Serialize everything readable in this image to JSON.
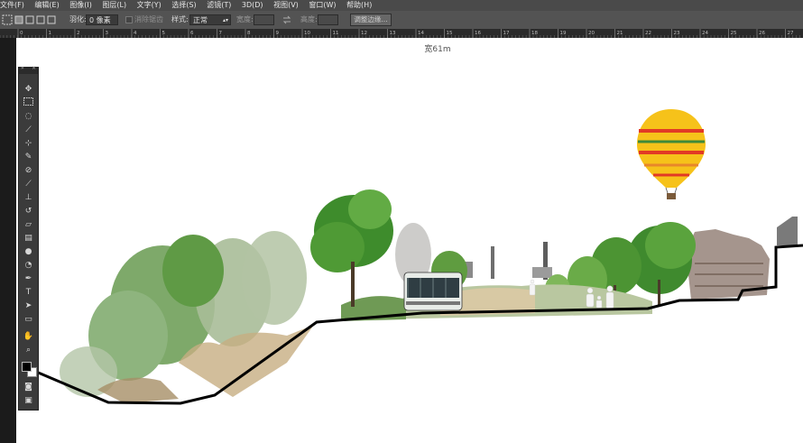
{
  "menu": [
    "文件(F)",
    "编辑(E)",
    "图像(I)",
    "图层(L)",
    "文字(Y)",
    "选择(S)",
    "滤镜(T)",
    "3D(D)",
    "视图(V)",
    "窗口(W)",
    "帮助(H)"
  ],
  "options": {
    "feather_label": "羽化:",
    "feather_value": "0 像素",
    "antialias_label": "消除锯齿",
    "style_label": "样式:",
    "style_value": "正常",
    "width_label": "宽度:",
    "height_label": "高度:",
    "refine_button": "调整边缘..."
  },
  "ruler": {
    "numbers": [
      "0",
      "1",
      "2",
      "3",
      "4",
      "5",
      "6",
      "7",
      "8",
      "9",
      "10",
      "11",
      "12",
      "13",
      "14",
      "15",
      "16",
      "17",
      "18",
      "19",
      "20",
      "21",
      "22",
      "23",
      "24",
      "25",
      "26",
      "27"
    ]
  },
  "canvas": {
    "dimension_label": "宽61m"
  },
  "tools": [
    "move-tool",
    "marquee-tool",
    "lasso-tool",
    "quick-selection-tool",
    "crop-tool",
    "eyedropper-tool",
    "healing-brush-tool",
    "brush-tool",
    "clone-stamp-tool",
    "history-brush-tool",
    "eraser-tool",
    "gradient-tool",
    "blur-tool",
    "dodge-tool",
    "pen-tool",
    "type-tool",
    "path-selection-tool",
    "rectangle-tool",
    "hand-tool",
    "zoom-tool",
    "color-swatches",
    "quick-mask-tool",
    "screen-mode-tool"
  ],
  "colors": {
    "menubar": "#4a4a4a",
    "optionsbar": "#535353",
    "canvas": "#ffffff",
    "section_line": "#000000"
  }
}
